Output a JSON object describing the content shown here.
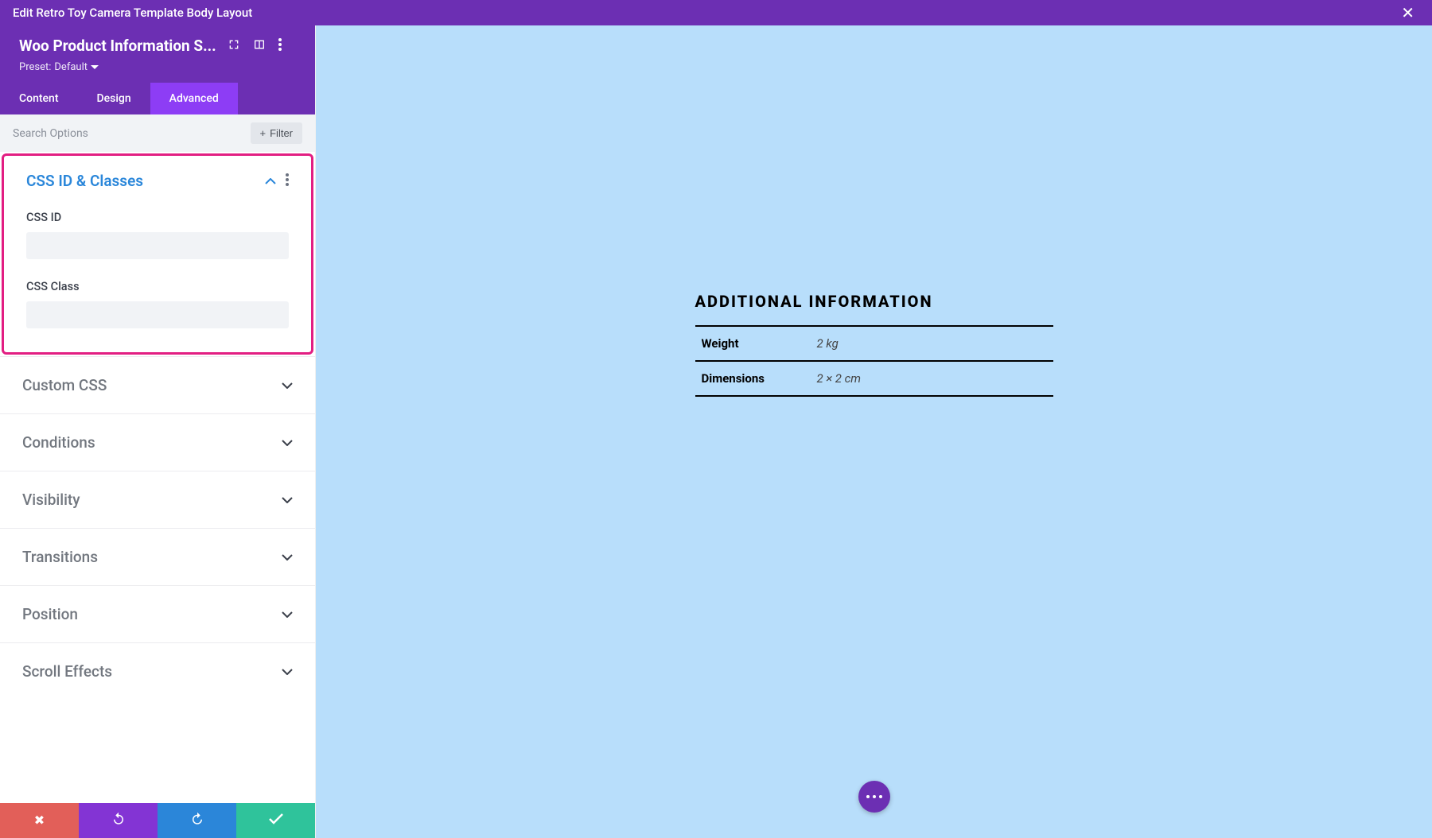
{
  "window": {
    "title": "Edit Retro Toy Camera Template Body Layout"
  },
  "module": {
    "title": "Woo Product Information S...",
    "preset_label": "Preset:",
    "preset_value": "Default"
  },
  "tabs": [
    {
      "label": "Content",
      "active": false
    },
    {
      "label": "Design",
      "active": false
    },
    {
      "label": "Advanced",
      "active": true
    }
  ],
  "search": {
    "placeholder": "Search Options",
    "filter_label": "Filter"
  },
  "highlight_panel": {
    "title": "CSS ID & Classes",
    "fields": [
      {
        "label": "CSS ID",
        "value": ""
      },
      {
        "label": "CSS Class",
        "value": ""
      }
    ]
  },
  "collapsed_panels": [
    {
      "label": "Custom CSS"
    },
    {
      "label": "Conditions"
    },
    {
      "label": "Visibility"
    },
    {
      "label": "Transitions"
    },
    {
      "label": "Position"
    },
    {
      "label": "Scroll Effects"
    }
  ],
  "preview": {
    "heading": "ADDITIONAL INFORMATION",
    "rows": [
      {
        "label": "Weight",
        "value": "2 kg"
      },
      {
        "label": "Dimensions",
        "value": "2 × 2 cm"
      }
    ]
  }
}
